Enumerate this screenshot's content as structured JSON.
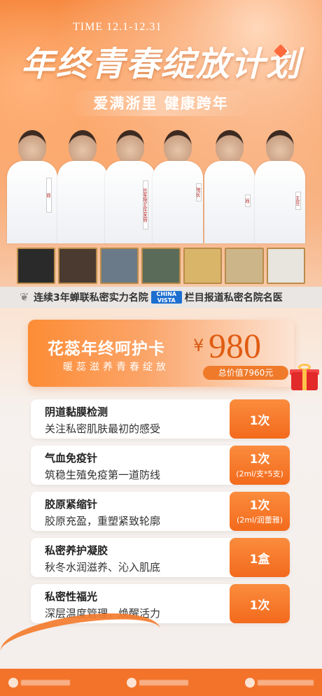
{
  "header": {
    "time": "TIME 12.1-12.31",
    "title": "年终青春绽放计划",
    "subtitle": "爱满浙里 健康跨年"
  },
  "doctors": [
    {
      "tag": "师"
    },
    {
      "tag": ""
    },
    {
      "tag": ""
    },
    {
      "tag": "总医院主任医师"
    },
    {
      "tag": "院长"
    },
    {
      "tag": "师"
    },
    {
      "tag": "主任"
    }
  ],
  "honor": {
    "left_text": "连续3年蝉联私密实力名院",
    "logo_text": "CHINA VISTA",
    "right_text": "栏目报道私密名院名医"
  },
  "card": {
    "title": "花蕊年终呵护卡",
    "subtitle": "暖蕊滋养青春绽放",
    "price_symbol": "¥",
    "price": "980",
    "total": "总价值7960元"
  },
  "items": [
    {
      "name": "阴道黏膜检测",
      "desc": "关注私密肌肤最初的感受",
      "count": "1次",
      "note": ""
    },
    {
      "name": "气血免疫针",
      "desc": "筑稳生殖免疫第一道防线",
      "count": "1次",
      "note": "(2ml/支*5支)"
    },
    {
      "name": "胶原紧缩针",
      "desc": "胶原充盈，重塑紧致轮廓",
      "count": "1次",
      "note": "(2ml/润蕾雅)"
    },
    {
      "name": "私密养护凝胶",
      "desc": "秋冬水润滋养、沁入肌底",
      "count": "1盒",
      "note": ""
    },
    {
      "name": "私密性福光",
      "desc": "深层温度管理，焕醒活力",
      "count": "1次",
      "note": ""
    }
  ],
  "colors": {
    "brand_orange": "#f36a1c",
    "accent_light": "#fba56a"
  }
}
